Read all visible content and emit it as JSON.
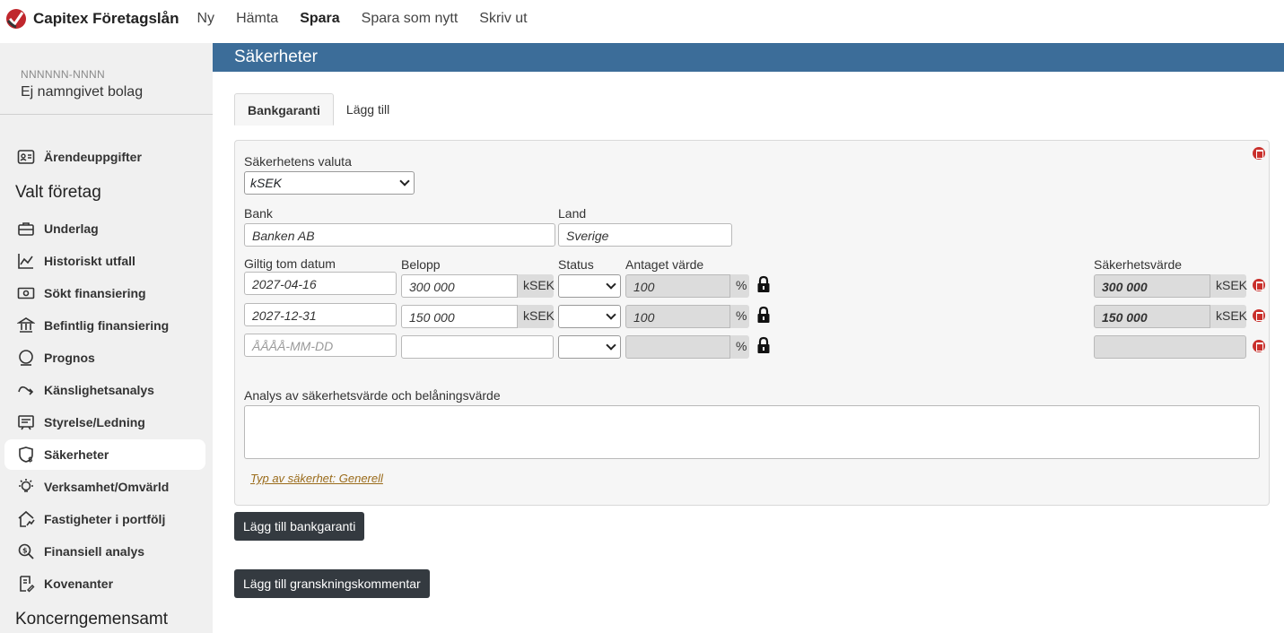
{
  "topbar": {
    "brand": "Capitex Företagslån",
    "nav": [
      "Ny",
      "Hämta",
      "Spara",
      "Spara som nytt",
      "Skriv ut"
    ]
  },
  "sidebar": {
    "company_id": "NNNNNN-NNNN",
    "company_name": "Ej namngivet bolag",
    "item_arende": "Ärendeuppgifter",
    "heading_valt": "Valt företag",
    "items": [
      "Underlag",
      "Historiskt utfall",
      "Sökt finansiering",
      "Befintlig finansiering",
      "Prognos",
      "Känslighetsanalys",
      "Styrelse/Ledning",
      "Säkerheter",
      "Verksamhet/Omvärld",
      "Fastigheter i portfölj",
      "Finansiell analys",
      "Kovenanter"
    ],
    "heading_koncern": "Koncerngemensamt",
    "active": "Säkerheter"
  },
  "main": {
    "title": "Säkerheter",
    "tabs": [
      "Bankgaranti",
      "Lägg till"
    ],
    "form": {
      "currency_label": "Säkerhetens valuta",
      "currency_value": "kSEK",
      "bank_label": "Bank",
      "bank_value": "Banken AB",
      "land_label": "Land",
      "land_value": "Sverige",
      "col_date": "Giltig tom datum",
      "col_amount": "Belopp",
      "col_status": "Status",
      "col_assumed": "Antaget värde",
      "col_security": "Säkerhetsvärde",
      "rows": [
        {
          "date": "2027-04-16",
          "amount": "300 000",
          "unit": "kSEK",
          "assumed": "100",
          "pct": "%",
          "security": "300 000",
          "sec_unit": "kSEK"
        },
        {
          "date": "2027-12-31",
          "amount": "150 000",
          "unit": "kSEK",
          "assumed": "100",
          "pct": "%",
          "security": "150 000",
          "sec_unit": "kSEK"
        },
        {
          "date_placeholder": "ÅÅÅÅ-MM-DD",
          "pct": "%"
        }
      ],
      "analysis_label": "Analys av säkerhetsvärde och belåningsvärde",
      "type_link": "Typ av säkerhet: Generell"
    },
    "btn_add_guarantee": "Lägg till bankgaranti",
    "btn_add_comment": "Lägg till granskningskommentar"
  },
  "colors": {
    "header": "#3c6d99",
    "dark_button": "#343a40",
    "delete": "#c9302c"
  }
}
